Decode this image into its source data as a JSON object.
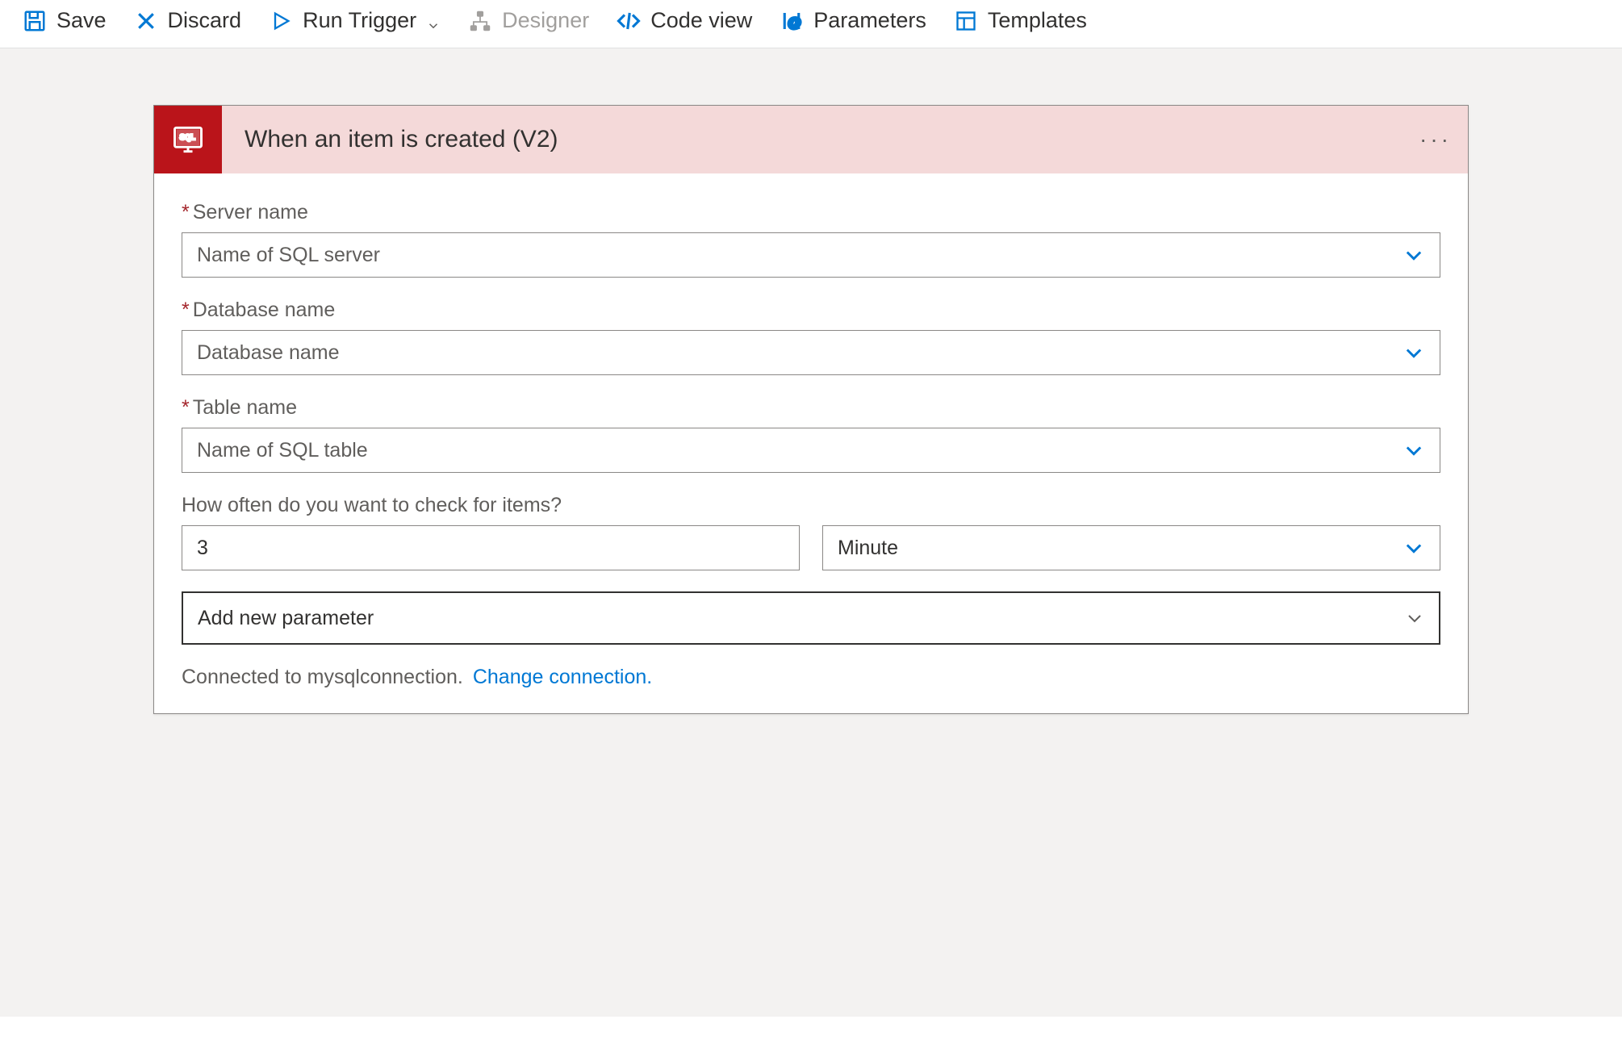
{
  "toolbar": {
    "save": "Save",
    "discard": "Discard",
    "run_trigger": "Run Trigger",
    "designer": "Designer",
    "code_view": "Code view",
    "parameters": "Parameters",
    "templates": "Templates"
  },
  "card": {
    "title": "When an item is created (V2)"
  },
  "fields": {
    "server_name": {
      "label": "Server name",
      "placeholder": "Name of SQL server"
    },
    "database_name": {
      "label": "Database name",
      "placeholder": "Database name"
    },
    "table_name": {
      "label": "Table name",
      "placeholder": "Name of SQL table"
    },
    "recurrence_label": "How often do you want to check for items?",
    "interval_value": "3",
    "frequency_value": "Minute",
    "add_param": "Add new parameter"
  },
  "connection": {
    "status": "Connected to mysqlconnection.",
    "change_link": "Change connection."
  }
}
